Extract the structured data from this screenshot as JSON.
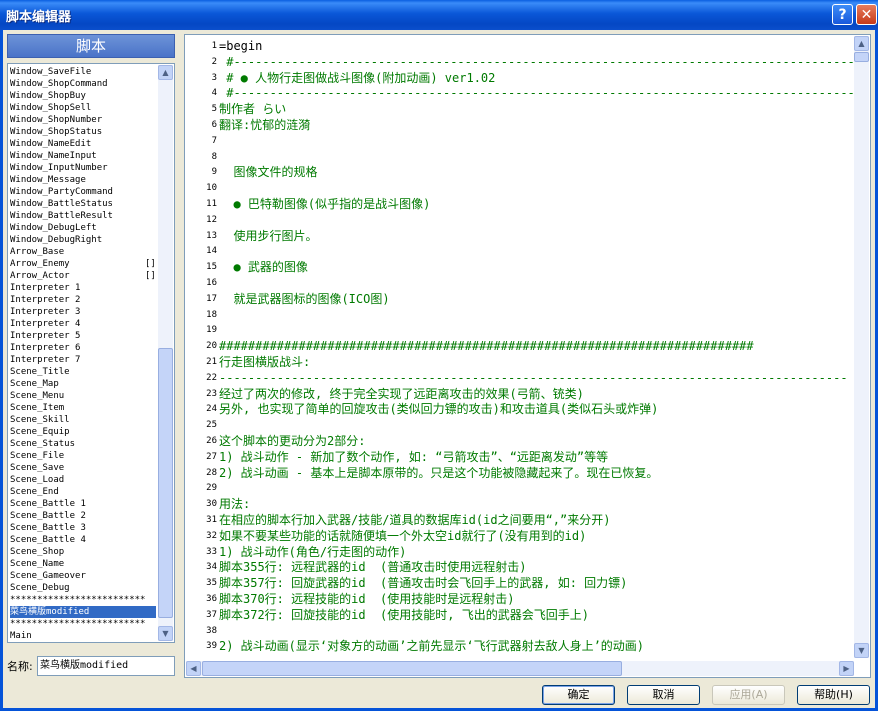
{
  "window": {
    "title": "脚本编辑器",
    "help_glyph": "?",
    "close_glyph": "✕"
  },
  "panel": {
    "header": "脚本"
  },
  "script_list": [
    {
      "label": "Window_SaveFile"
    },
    {
      "label": "Window_ShopCommand"
    },
    {
      "label": "Window_ShopBuy"
    },
    {
      "label": "Window_ShopSell"
    },
    {
      "label": "Window_ShopNumber"
    },
    {
      "label": "Window_ShopStatus"
    },
    {
      "label": "Window_NameEdit"
    },
    {
      "label": "Window_NameInput"
    },
    {
      "label": "Window_InputNumber"
    },
    {
      "label": "Window_Message"
    },
    {
      "label": "Window_PartyCommand"
    },
    {
      "label": "Window_BattleStatus"
    },
    {
      "label": "Window_BattleResult"
    },
    {
      "label": "Window_DebugLeft"
    },
    {
      "label": "Window_DebugRight"
    },
    {
      "label": "Arrow_Base"
    },
    {
      "label": "Arrow_Enemy",
      "mark": "[]"
    },
    {
      "label": "Arrow_Actor",
      "mark": "[]"
    },
    {
      "label": "Interpreter 1"
    },
    {
      "label": "Interpreter 2"
    },
    {
      "label": "Interpreter 3"
    },
    {
      "label": "Interpreter 4"
    },
    {
      "label": "Interpreter 5"
    },
    {
      "label": "Interpreter 6"
    },
    {
      "label": "Interpreter 7"
    },
    {
      "label": "Scene_Title"
    },
    {
      "label": "Scene_Map"
    },
    {
      "label": "Scene_Menu"
    },
    {
      "label": "Scene_Item"
    },
    {
      "label": "Scene_Skill"
    },
    {
      "label": "Scene_Equip"
    },
    {
      "label": "Scene_Status"
    },
    {
      "label": "Scene_File"
    },
    {
      "label": "Scene_Save"
    },
    {
      "label": "Scene_Load"
    },
    {
      "label": "Scene_End"
    },
    {
      "label": "Scene_Battle 1"
    },
    {
      "label": "Scene_Battle 2"
    },
    {
      "label": "Scene_Battle 3"
    },
    {
      "label": "Scene_Battle 4"
    },
    {
      "label": "Scene_Shop"
    },
    {
      "label": "Scene_Name"
    },
    {
      "label": "Scene_Gameover"
    },
    {
      "label": "Scene_Debug"
    },
    {
      "label": "*************************"
    },
    {
      "label": "菜鸟横版modified",
      "selected": true
    },
    {
      "label": "*************************"
    },
    {
      "label": "Main"
    }
  ],
  "name_field": {
    "label": "名称:",
    "value": "菜鸟横版modified"
  },
  "code_lines": [
    {
      "n": "1",
      "text": "=begin",
      "color": "black"
    },
    {
      "n": "2",
      "text": " #---------------------------------------------------------------------------------------"
    },
    {
      "n": "3",
      "text": " # ● 人物行走图做战斗图像(附加动画) ver1.02"
    },
    {
      "n": "4",
      "text": " #---------------------------------------------------------------------------------------"
    },
    {
      "n": "5",
      "text": "制作者 らい"
    },
    {
      "n": "6",
      "text": "翻译:忧郁的涟漪"
    },
    {
      "n": "7",
      "text": ""
    },
    {
      "n": "8",
      "text": ""
    },
    {
      "n": "9",
      "text": "  图像文件的规格"
    },
    {
      "n": "10",
      "text": ""
    },
    {
      "n": "11",
      "text": "  ● 巴特勒图像(似乎指的是战斗图像)"
    },
    {
      "n": "12",
      "text": ""
    },
    {
      "n": "13",
      "text": "  使用步行图片。"
    },
    {
      "n": "14",
      "text": ""
    },
    {
      "n": "15",
      "text": "  ● 武器的图像"
    },
    {
      "n": "16",
      "text": ""
    },
    {
      "n": "17",
      "text": "  就是武器图标的图像(ICO图)"
    },
    {
      "n": "18",
      "text": ""
    },
    {
      "n": "19",
      "text": ""
    },
    {
      "n": "20",
      "text": "##########################################################################"
    },
    {
      "n": "21",
      "text": "行走图横版战斗:"
    },
    {
      "n": "22",
      "text": "---------------------------------------------------------------------------------------"
    },
    {
      "n": "23",
      "text": "经过了两次的修改, 终于完全实现了远距离攻击的效果(弓箭、铳类)"
    },
    {
      "n": "24",
      "text": "另外, 也实现了简单的回旋攻击(类似回力镖的攻击)和攻击道具(类似石头或炸弹)"
    },
    {
      "n": "25",
      "text": ""
    },
    {
      "n": "26",
      "text": "这个脚本的更动分为2部分:"
    },
    {
      "n": "27",
      "text": "1) 战斗动作 - 新加了数个动作, 如: “弓箭攻击”、“远距离发动”等等"
    },
    {
      "n": "28",
      "text": "2) 战斗动画 - 基本上是脚本原带的。只是这个功能被隐藏起来了。现在已恢复。"
    },
    {
      "n": "29",
      "text": ""
    },
    {
      "n": "30",
      "text": "用法:"
    },
    {
      "n": "31",
      "text": "在相应的脚本行加入武器/技能/道具的数据库id(id之间要用“,”来分开)"
    },
    {
      "n": "32",
      "text": "如果不要某些功能的话就随便填一个外太空id就行了(没有用到的id)"
    },
    {
      "n": "33",
      "text": "1) 战斗动作(角色/行走图的动作)"
    },
    {
      "n": "34",
      "text": "脚本355行: 远程武器的id  (普通攻击时使用远程射击)"
    },
    {
      "n": "35",
      "text": "脚本357行: 回旋武器的id  (普通攻击时会飞回手上的武器, 如: 回力镖)"
    },
    {
      "n": "36",
      "text": "脚本370行: 远程技能的id  (使用技能时是远程射击)"
    },
    {
      "n": "37",
      "text": "脚本372行: 回旋技能的id  (使用技能时, 飞出的武器会飞回手上)"
    },
    {
      "n": "38",
      "text": ""
    },
    {
      "n": "39",
      "text": "2) 战斗动画(显示‘对象方的动画’之前先显示‘飞行武器射去敌人身上’的动画)"
    }
  ],
  "buttons": {
    "ok": "确定",
    "cancel": "取消",
    "apply": "应用(A)",
    "help": "帮助(H)"
  }
}
